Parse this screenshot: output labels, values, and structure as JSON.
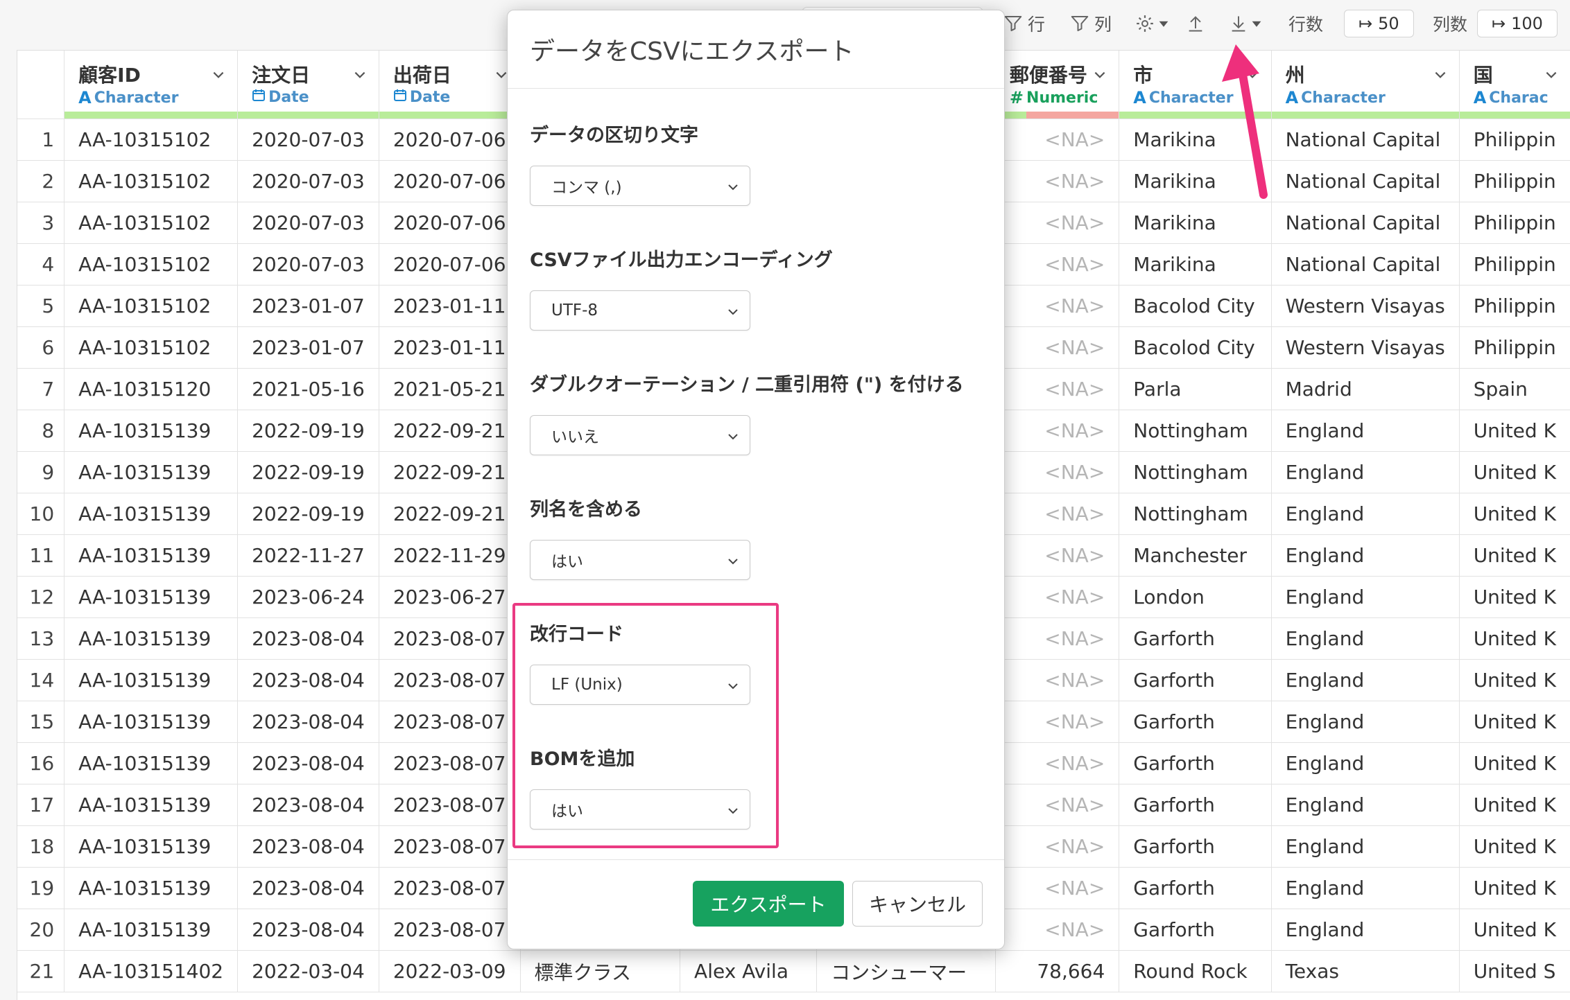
{
  "toolbar": {
    "row_filter_label": "行",
    "col_filter_label": "列",
    "row_count_label": "行数",
    "row_count_value": "50",
    "col_count_label": "列数",
    "col_count_value": "100"
  },
  "table": {
    "columns": [
      {
        "name": "顧客ID",
        "type": "Character",
        "type_kind": "character"
      },
      {
        "name": "注文日",
        "type": "Date",
        "type_kind": "date"
      },
      {
        "name": "出荷日",
        "type": "Date",
        "type_kind": "date"
      },
      {
        "name": "",
        "type": "",
        "type_kind": ""
      },
      {
        "name": "",
        "type": "",
        "type_kind": ""
      },
      {
        "name": "",
        "type": "",
        "type_kind": ""
      },
      {
        "name": "郵便番号",
        "type": "Numeric",
        "type_kind": "numeric"
      },
      {
        "name": "市",
        "type": "Character",
        "type_kind": "character"
      },
      {
        "name": "州",
        "type": "Character",
        "type_kind": "character"
      },
      {
        "name": "国",
        "type": "Charac",
        "type_kind": "character"
      }
    ],
    "rows": [
      [
        "1",
        "AA-10315102",
        "2020-07-03",
        "2020-07-06",
        "",
        "",
        "",
        "<NA>",
        "Marikina",
        "National Capital",
        "Philippin"
      ],
      [
        "2",
        "AA-10315102",
        "2020-07-03",
        "2020-07-06",
        "",
        "",
        "",
        "<NA>",
        "Marikina",
        "National Capital",
        "Philippin"
      ],
      [
        "3",
        "AA-10315102",
        "2020-07-03",
        "2020-07-06",
        "",
        "",
        "",
        "<NA>",
        "Marikina",
        "National Capital",
        "Philippin"
      ],
      [
        "4",
        "AA-10315102",
        "2020-07-03",
        "2020-07-06",
        "",
        "",
        "",
        "<NA>",
        "Marikina",
        "National Capital",
        "Philippin"
      ],
      [
        "5",
        "AA-10315102",
        "2023-01-07",
        "2023-01-11",
        "",
        "",
        "",
        "<NA>",
        "Bacolod City",
        "Western Visayas",
        "Philippin"
      ],
      [
        "6",
        "AA-10315102",
        "2023-01-07",
        "2023-01-11",
        "",
        "",
        "",
        "<NA>",
        "Bacolod City",
        "Western Visayas",
        "Philippin"
      ],
      [
        "7",
        "AA-10315120",
        "2021-05-16",
        "2021-05-21",
        "",
        "",
        "",
        "<NA>",
        "Parla",
        "Madrid",
        "Spain"
      ],
      [
        "8",
        "AA-10315139",
        "2022-09-19",
        "2022-09-21",
        "",
        "",
        "",
        "<NA>",
        "Nottingham",
        "England",
        "United K"
      ],
      [
        "9",
        "AA-10315139",
        "2022-09-19",
        "2022-09-21",
        "",
        "",
        "",
        "<NA>",
        "Nottingham",
        "England",
        "United K"
      ],
      [
        "10",
        "AA-10315139",
        "2022-09-19",
        "2022-09-21",
        "",
        "",
        "",
        "<NA>",
        "Nottingham",
        "England",
        "United K"
      ],
      [
        "11",
        "AA-10315139",
        "2022-11-27",
        "2022-11-29",
        "",
        "",
        "",
        "<NA>",
        "Manchester",
        "England",
        "United K"
      ],
      [
        "12",
        "AA-10315139",
        "2023-06-24",
        "2023-06-27",
        "",
        "",
        "",
        "<NA>",
        "London",
        "England",
        "United K"
      ],
      [
        "13",
        "AA-10315139",
        "2023-08-04",
        "2023-08-07",
        "",
        "",
        "",
        "<NA>",
        "Garforth",
        "England",
        "United K"
      ],
      [
        "14",
        "AA-10315139",
        "2023-08-04",
        "2023-08-07",
        "",
        "",
        "",
        "<NA>",
        "Garforth",
        "England",
        "United K"
      ],
      [
        "15",
        "AA-10315139",
        "2023-08-04",
        "2023-08-07",
        "",
        "",
        "",
        "<NA>",
        "Garforth",
        "England",
        "United K"
      ],
      [
        "16",
        "AA-10315139",
        "2023-08-04",
        "2023-08-07",
        "",
        "",
        "",
        "<NA>",
        "Garforth",
        "England",
        "United K"
      ],
      [
        "17",
        "AA-10315139",
        "2023-08-04",
        "2023-08-07",
        "",
        "",
        "",
        "<NA>",
        "Garforth",
        "England",
        "United K"
      ],
      [
        "18",
        "AA-10315139",
        "2023-08-04",
        "2023-08-07",
        "",
        "",
        "",
        "<NA>",
        "Garforth",
        "England",
        "United K"
      ],
      [
        "19",
        "AA-10315139",
        "2023-08-04",
        "2023-08-07",
        "",
        "",
        "",
        "<NA>",
        "Garforth",
        "England",
        "United K"
      ],
      [
        "20",
        "AA-10315139",
        "2023-08-04",
        "2023-08-07",
        "",
        "",
        "",
        "<NA>",
        "Garforth",
        "England",
        "United K"
      ],
      [
        "21",
        "AA-103151402",
        "2022-03-04",
        "2022-03-09",
        "標準クラス",
        "Alex Avila",
        "コンシューマー",
        "78,664",
        "Round Rock",
        "Texas",
        "United S"
      ]
    ]
  },
  "modal": {
    "title": "データをCSVにエクスポート",
    "fields": [
      {
        "label": "データの区切り文字",
        "value": "コンマ (,)"
      },
      {
        "label": "CSVファイル出力エンコーディング",
        "value": "UTF-8"
      },
      {
        "label": "ダブルクオーテーション / 二重引用符 (\") を付ける",
        "value": "いいえ"
      },
      {
        "label": "列名を含める",
        "value": "はい"
      },
      {
        "label": "改行コード",
        "value": "LF (Unix)"
      },
      {
        "label": "BOMを追加",
        "value": "はい"
      }
    ],
    "export_button": "エクスポート",
    "cancel_button": "キャンセル"
  },
  "colors": {
    "accent_green": "#17a25f",
    "highlight_pink": "#ea3a82",
    "quality_ok": "#b9ec9a",
    "quality_missing": "#f4a6a0"
  }
}
